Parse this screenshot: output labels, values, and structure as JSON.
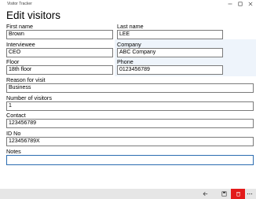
{
  "window": {
    "title": "Visitor Tracker"
  },
  "page": {
    "title": "Edit visitors"
  },
  "form": {
    "first_name": {
      "label": "First name",
      "value": "Brown"
    },
    "last_name": {
      "label": "Last name",
      "value": "LEE"
    },
    "interviewee": {
      "label": "Interviewee",
      "value": "CEO"
    },
    "company": {
      "label": "Company",
      "value": "ABC Company"
    },
    "floor": {
      "label": "Floor",
      "value": "18th floor"
    },
    "phone": {
      "label": "Phone",
      "value": "0123456789"
    },
    "reason": {
      "label": "Reason for visit",
      "value": "Business"
    },
    "num_visitors": {
      "label": "Number of visitors",
      "value": "1"
    },
    "contact": {
      "label": "Contact",
      "value": "123456789"
    },
    "id_no": {
      "label": "ID No",
      "value": "123456789X"
    },
    "notes": {
      "label": "Notes",
      "value": ""
    }
  },
  "colors": {
    "accent": "#2b6cb0",
    "danger": "#e31b1b",
    "highlight": "#eef4fb",
    "appbar": "#e6e6e6"
  },
  "appbar": {
    "buttons": [
      {
        "icon": "back-arrow-icon"
      },
      {
        "icon": "save-icon"
      },
      {
        "icon": "delete-icon"
      },
      {
        "icon": "more-icon"
      }
    ]
  }
}
